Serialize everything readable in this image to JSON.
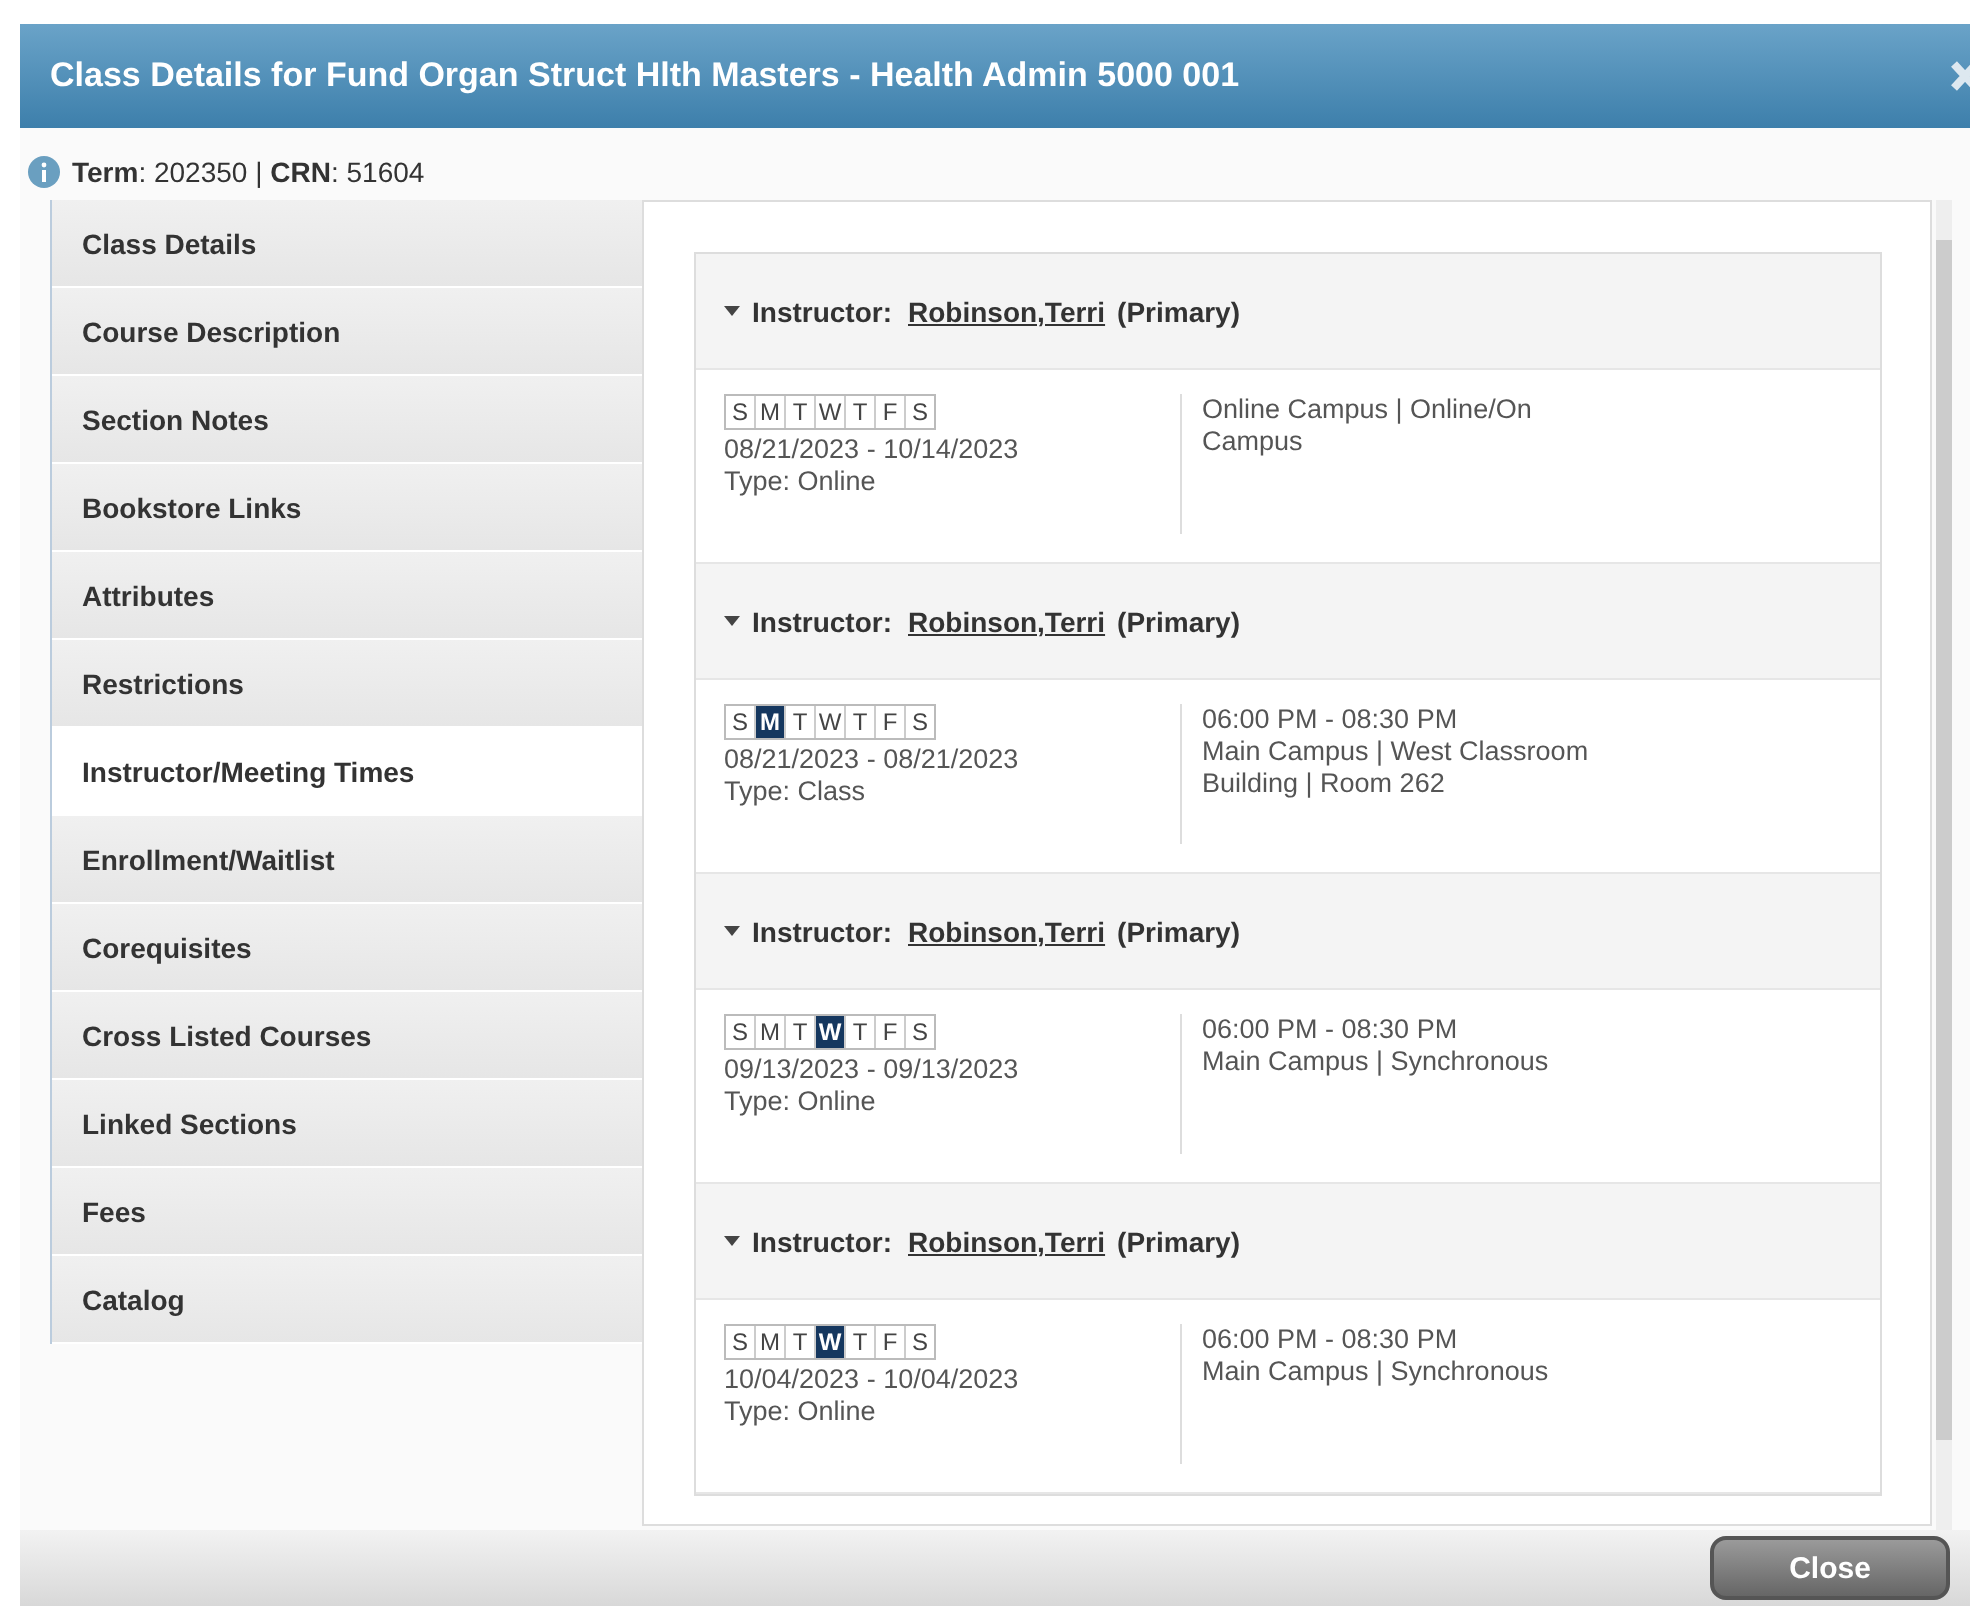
{
  "dialog": {
    "title": "Class Details for Fund Organ Struct Hlth Masters - Health Admin 5000 001"
  },
  "info": {
    "text": "**Term**: 202350 | **CRN**: 51604"
  },
  "sidebar": {
    "items": [
      {
        "label": "Class Details",
        "selected": false
      },
      {
        "label": "Course Description",
        "selected": false
      },
      {
        "label": "Section Notes",
        "selected": false
      },
      {
        "label": "Bookstore Links",
        "selected": false
      },
      {
        "label": "Attributes",
        "selected": false
      },
      {
        "label": "Restrictions",
        "selected": false
      },
      {
        "label": "Instructor/Meeting Times",
        "selected": true
      },
      {
        "label": "Enrollment/Waitlist",
        "selected": false
      },
      {
        "label": "Corequisites",
        "selected": false
      },
      {
        "label": "Cross Listed Courses",
        "selected": false
      },
      {
        "label": "Linked Sections",
        "selected": false
      },
      {
        "label": "Fees",
        "selected": false
      },
      {
        "label": "Catalog",
        "selected": false
      }
    ]
  },
  "meetings": [
    {
      "instructor_label": "Instructor:",
      "instructor": "Robinson,Terri",
      "role": "(Primary)",
      "days": [
        {
          "letter": "S",
          "selected": false
        },
        {
          "letter": "M",
          "selected": false
        },
        {
          "letter": "T",
          "selected": false
        },
        {
          "letter": "W",
          "selected": false
        },
        {
          "letter": "T",
          "selected": false
        },
        {
          "letter": "F",
          "selected": false
        },
        {
          "letter": "S",
          "selected": false
        }
      ],
      "dates": "08/21/2023 - 10/14/2023",
      "type": "Type: Online",
      "location": "Online Campus | Online/On Campus"
    },
    {
      "instructor_label": "Instructor:",
      "instructor": "Robinson,Terri",
      "role": "(Primary)",
      "days": [
        {
          "letter": "S",
          "selected": false
        },
        {
          "letter": "M",
          "selected": true
        },
        {
          "letter": "T",
          "selected": false
        },
        {
          "letter": "W",
          "selected": false
        },
        {
          "letter": "T",
          "selected": false
        },
        {
          "letter": "F",
          "selected": false
        },
        {
          "letter": "S",
          "selected": false
        }
      ],
      "dates": "08/21/2023 - 08/21/2023",
      "type": "Type: Class",
      "time": "06:00 PM - 08:30 PM",
      "location": "Main Campus | West Classroom Building | Room 262"
    },
    {
      "instructor_label": "Instructor:",
      "instructor": "Robinson,Terri",
      "role": "(Primary)",
      "days": [
        {
          "letter": "S",
          "selected": false
        },
        {
          "letter": "M",
          "selected": false
        },
        {
          "letter": "T",
          "selected": false
        },
        {
          "letter": "W",
          "selected": true
        },
        {
          "letter": "T",
          "selected": false
        },
        {
          "letter": "F",
          "selected": false
        },
        {
          "letter": "S",
          "selected": false
        }
      ],
      "dates": "09/13/2023 - 09/13/2023",
      "type": "Type: Online",
      "time": "06:00 PM - 08:30 PM",
      "location": "Main Campus | Synchronous"
    },
    {
      "instructor_label": "Instructor:",
      "instructor": "Robinson,Terri",
      "role": "(Primary)",
      "days": [
        {
          "letter": "S",
          "selected": false
        },
        {
          "letter": "M",
          "selected": false
        },
        {
          "letter": "T",
          "selected": false
        },
        {
          "letter": "W",
          "selected": true
        },
        {
          "letter": "T",
          "selected": false
        },
        {
          "letter": "F",
          "selected": false
        },
        {
          "letter": "S",
          "selected": false
        }
      ],
      "dates": "10/04/2023 - 10/04/2023",
      "type": "Type: Online",
      "time": "06:00 PM - 08:30 PM",
      "location": "Main Campus | Synchronous"
    }
  ],
  "buttons": [
    {
      "label": "Close"
    }
  ]
}
